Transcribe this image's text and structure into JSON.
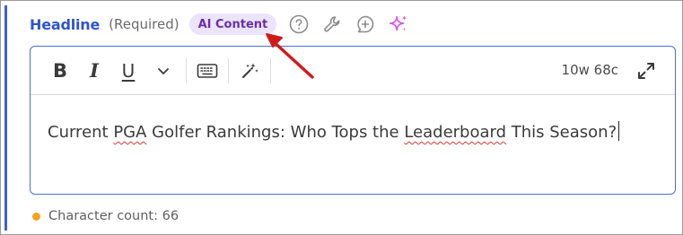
{
  "field": {
    "label": "Headline",
    "required_text": "(Required)",
    "ai_badge": "AI Content",
    "icons": [
      "help-circle-icon",
      "wrench-icon",
      "add-comment-icon",
      "sparkle-icon"
    ]
  },
  "toolbar": {
    "bold": "B",
    "italic": "I",
    "underline": "U",
    "more_icon": "chevron-down-icon",
    "keyboard_icon": "keyboard-icon",
    "magic_icon": "magic-wand-icon",
    "word_count": "10w 68c",
    "expand_icon": "expand-icon"
  },
  "editor": {
    "text_before": "Current ",
    "word_pga": "PGA",
    "text_middle": " Golfer Rankings: Who Tops the ",
    "word_leaderboard": "Leaderboard",
    "text_after": " This Season?"
  },
  "footer": {
    "char_count": "Character count: 66"
  },
  "colors": {
    "accent": "#2f55c8",
    "badge_bg": "#ece4fb",
    "badge_text": "#6a2fa8",
    "status_dot": "#f2a320",
    "annotation_arrow": "#d11a1a"
  }
}
